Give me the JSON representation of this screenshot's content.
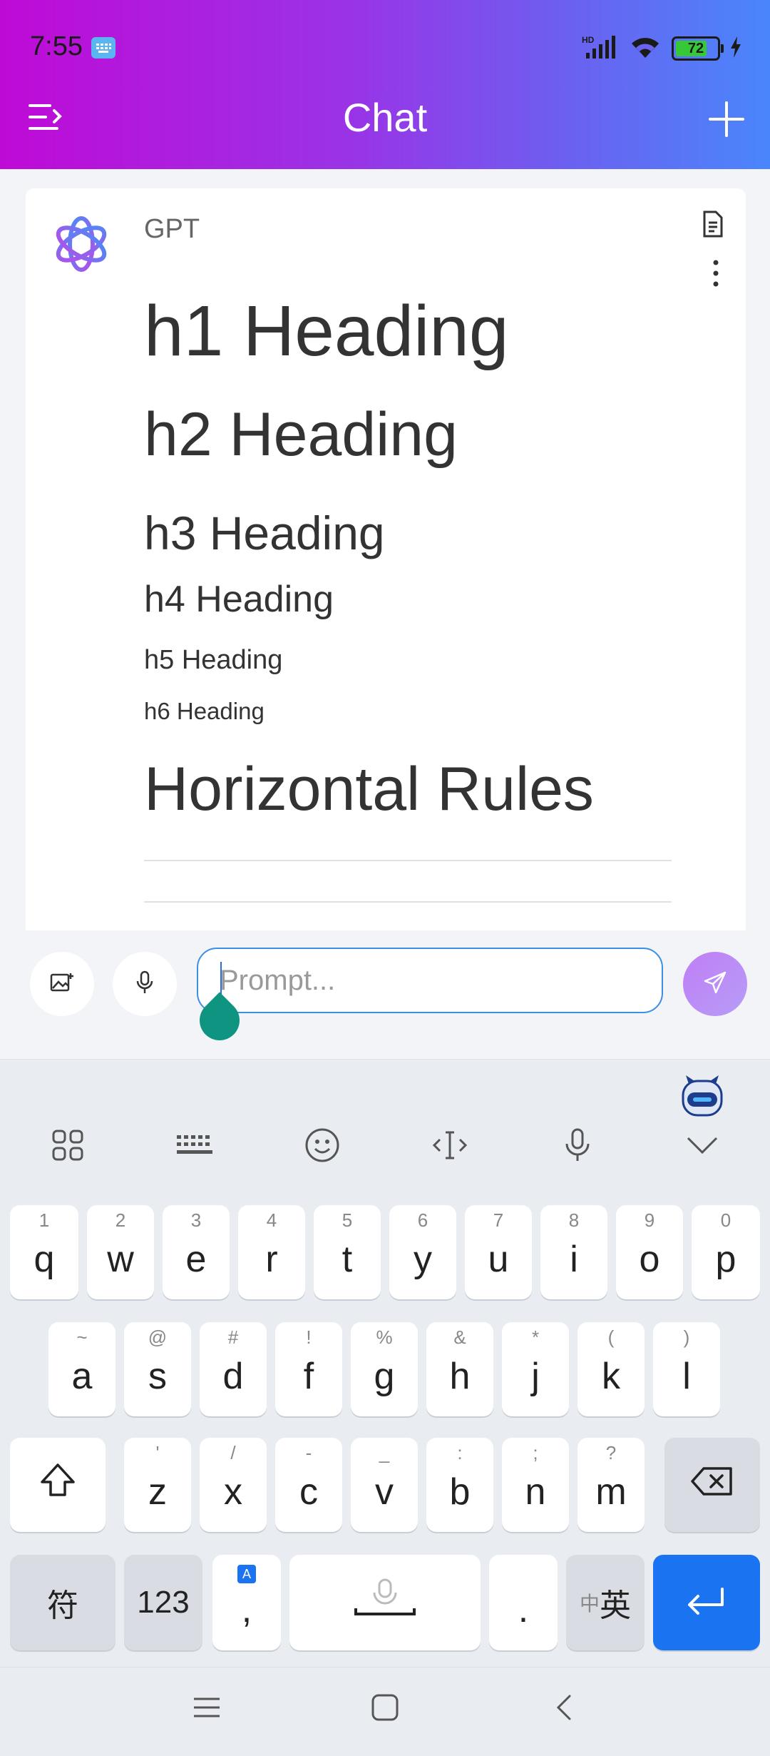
{
  "status_bar": {
    "time": "7:55",
    "battery": "72"
  },
  "header": {
    "title": "Chat"
  },
  "message": {
    "sender": "GPT",
    "h1": "h1 Heading",
    "h2": "h2 Heading",
    "h3": "h3 Heading",
    "h4": "h4 Heading",
    "h5": "h5 Heading",
    "h6": "h6 Heading",
    "section": "Horizontal Rules"
  },
  "composer": {
    "placeholder": "Prompt..."
  },
  "keyboard": {
    "row1": [
      {
        "hint": "1",
        "key": "q"
      },
      {
        "hint": "2",
        "key": "w"
      },
      {
        "hint": "3",
        "key": "e"
      },
      {
        "hint": "4",
        "key": "r"
      },
      {
        "hint": "5",
        "key": "t"
      },
      {
        "hint": "6",
        "key": "y"
      },
      {
        "hint": "7",
        "key": "u"
      },
      {
        "hint": "8",
        "key": "i"
      },
      {
        "hint": "9",
        "key": "o"
      },
      {
        "hint": "0",
        "key": "p"
      }
    ],
    "row2": [
      {
        "hint": "~",
        "key": "a"
      },
      {
        "hint": "@",
        "key": "s"
      },
      {
        "hint": "#",
        "key": "d"
      },
      {
        "hint": "!",
        "key": "f"
      },
      {
        "hint": "%",
        "key": "g"
      },
      {
        "hint": "&",
        "key": "h"
      },
      {
        "hint": "*",
        "key": "j"
      },
      {
        "hint": "(",
        "key": "k"
      },
      {
        "hint": ")",
        "key": "l"
      }
    ],
    "row3": [
      {
        "hint": "'",
        "key": "z"
      },
      {
        "hint": "/",
        "key": "x"
      },
      {
        "hint": "-",
        "key": "c"
      },
      {
        "hint": "_",
        "key": "v"
      },
      {
        "hint": ":",
        "key": "b"
      },
      {
        "hint": ";",
        "key": "n"
      },
      {
        "hint": "?",
        "key": "m"
      }
    ],
    "symbols_key": "符",
    "numbers_key": "123",
    "comma_key": ",",
    "comma_badge": "A",
    "period_key": ".",
    "lang_key_small": "中",
    "lang_key": "英"
  }
}
